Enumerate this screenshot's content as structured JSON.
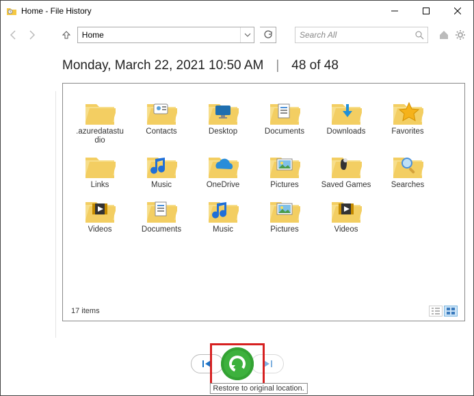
{
  "titlebar": {
    "title": "Home - File History"
  },
  "toolbar": {
    "address": "Home",
    "search_placeholder": "Search All"
  },
  "header": {
    "datetime": "Monday, March 22, 2021 10:50 AM",
    "separator": "|",
    "counter": "48 of 48"
  },
  "items": [
    {
      "label": ".azuredatastudio",
      "overlay": "none"
    },
    {
      "label": "Contacts",
      "overlay": "contacts"
    },
    {
      "label": "Desktop",
      "overlay": "desktop"
    },
    {
      "label": "Documents",
      "overlay": "documents"
    },
    {
      "label": "Downloads",
      "overlay": "downloads"
    },
    {
      "label": "Favorites",
      "overlay": "favorites"
    },
    {
      "label": "Links",
      "overlay": "none"
    },
    {
      "label": "Music",
      "overlay": "music"
    },
    {
      "label": "OneDrive",
      "overlay": "onedrive"
    },
    {
      "label": "Pictures",
      "overlay": "pictures"
    },
    {
      "label": "Saved Games",
      "overlay": "games"
    },
    {
      "label": "Searches",
      "overlay": "search"
    },
    {
      "label": "Videos",
      "overlay": "videos"
    },
    {
      "label": "Documents",
      "overlay": "documents"
    },
    {
      "label": "Music",
      "overlay": "music"
    },
    {
      "label": "Pictures",
      "overlay": "pictures"
    },
    {
      "label": "Videos",
      "overlay": "videos"
    }
  ],
  "status": {
    "count_text": "17 items"
  },
  "tooltip": {
    "text": "Restore to original location."
  }
}
